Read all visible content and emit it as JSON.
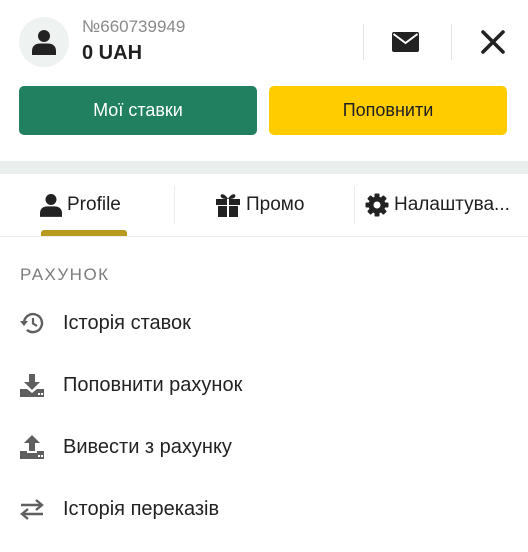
{
  "header": {
    "account_number": "№660739949",
    "balance": "0 UAH",
    "icons": {
      "avatar": "user-icon",
      "mail": "envelope-icon",
      "close": "close-icon"
    }
  },
  "actions": {
    "my_bets_label": "Мої ставки",
    "top_up_label": "Поповнити"
  },
  "tabs": [
    {
      "label": "Profile",
      "icon": "user-icon",
      "active": true
    },
    {
      "label": "Промо",
      "icon": "gift-icon",
      "active": false
    },
    {
      "label": "Налаштува...",
      "icon": "gear-icon",
      "active": false
    }
  ],
  "section": {
    "title": "РАХУНОК",
    "items": [
      {
        "label": "Історія ставок",
        "icon": "history-icon"
      },
      {
        "label": "Поповнити рахунок",
        "icon": "download-icon"
      },
      {
        "label": "Вивести з рахунку",
        "icon": "upload-icon"
      },
      {
        "label": "Історія переказів",
        "icon": "transfer-arrows-icon"
      }
    ]
  },
  "colors": {
    "primary_green": "#208060",
    "accent_yellow": "#ffcc00",
    "tab_indicator": "#b89a1e",
    "band": "#e9efec"
  }
}
